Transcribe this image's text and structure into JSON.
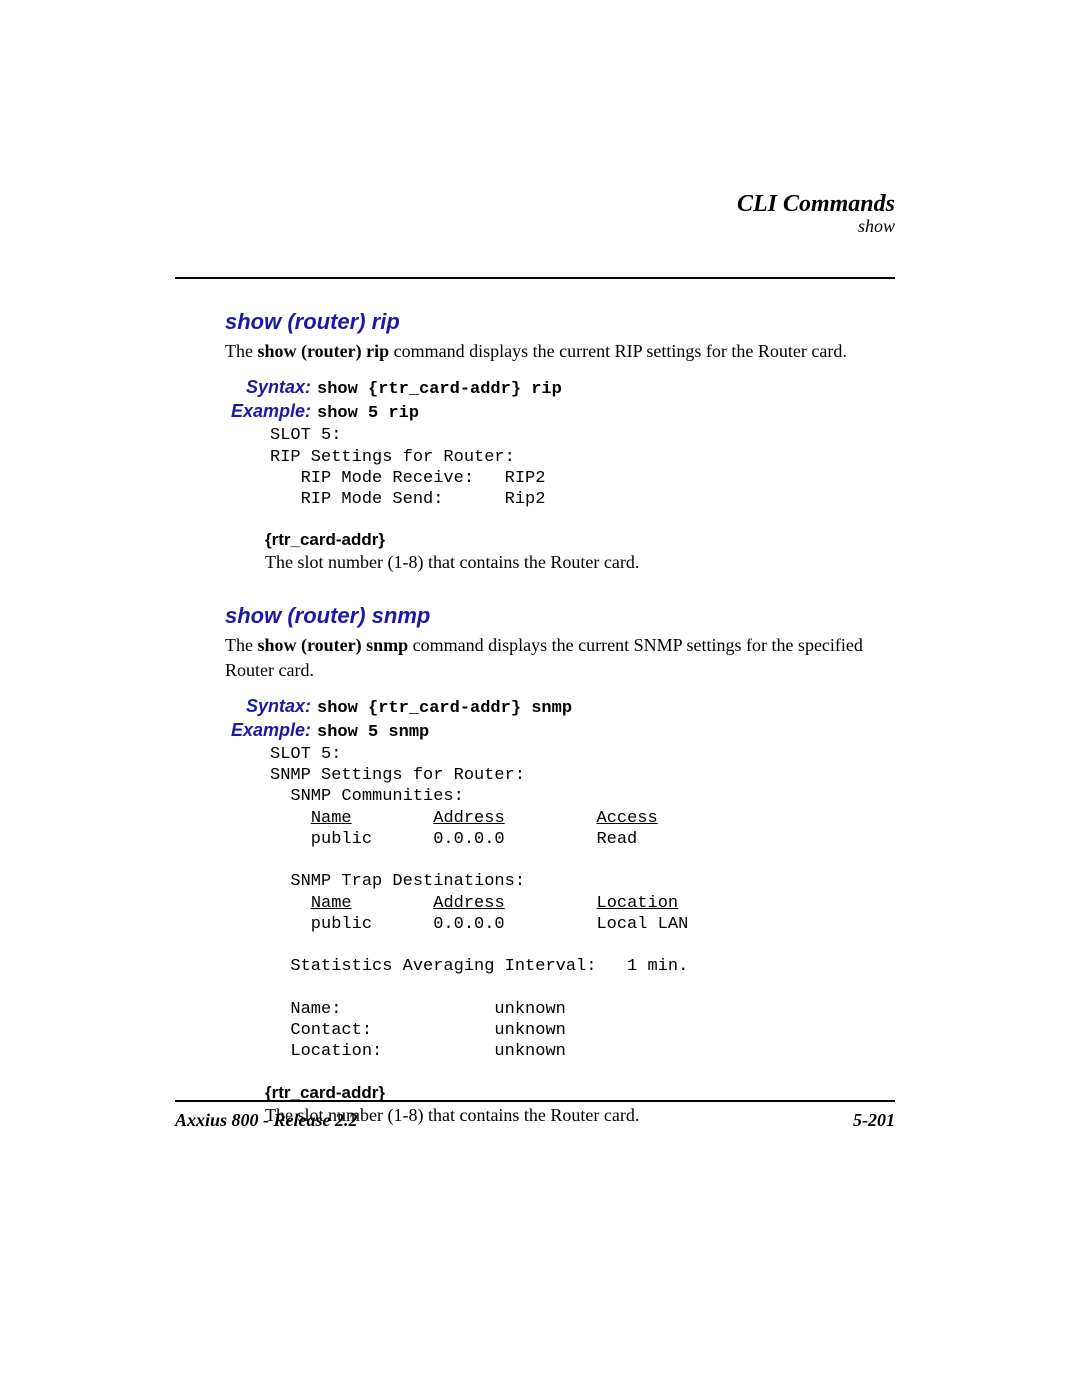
{
  "header": {
    "chapter": "CLI Commands",
    "section": "show"
  },
  "sec1": {
    "title": "show (router) rip",
    "intro_pre": "The ",
    "intro_cmd": "show (router) rip",
    "intro_post": " command displays the current RIP settings for the Router card.",
    "syntax_label": "Syntax:",
    "syntax_text": "show {rtr_card-addr} rip",
    "example_label": "Example:",
    "example_text": "show 5 rip",
    "output": "SLOT 5:\nRIP Settings for Router:\n   RIP Mode Receive:   RIP2\n   RIP Mode Send:      Rip2",
    "param_head": "{rtr_card-addr}",
    "param_desc": "The slot number (1-8) that contains the Router card."
  },
  "sec2": {
    "title": "show (router) snmp",
    "intro_pre": "The ",
    "intro_cmd": "show (router) snmp",
    "intro_post": " command displays the current SNMP settings for the specified Router card.",
    "syntax_label": "Syntax:",
    "syntax_text": "show {rtr_card-addr} snmp",
    "example_label": "Example:",
    "example_text": "show 5 snmp",
    "out": {
      "l1": "SLOT 5:",
      "l2": "SNMP Settings for Router:",
      "l3": "  SNMP Communities:",
      "h1a": "Name",
      "h1b": "Address",
      "h1c": "Access",
      "r1a": "public",
      "r1b": "0.0.0.0",
      "r1c": "Read",
      "l4": "  SNMP Trap Destinations:",
      "h2a": "Name",
      "h2b": "Address",
      "h2c": "Location",
      "r2a": "public",
      "r2b": "0.0.0.0",
      "r2c": "Local LAN",
      "lstat": "  Statistics Averaging Interval:   1 min.",
      "n1a": "Name:",
      "n1b": "unknown",
      "n2a": "Contact:",
      "n2b": "unknown",
      "n3a": "Location:",
      "n3b": "unknown"
    },
    "param_head": "{rtr_card-addr}",
    "param_desc": "The slot number (1-8) that contains the Router card."
  },
  "footer": {
    "left": "Axxius 800 - Release 2.2",
    "right": "5-201"
  }
}
